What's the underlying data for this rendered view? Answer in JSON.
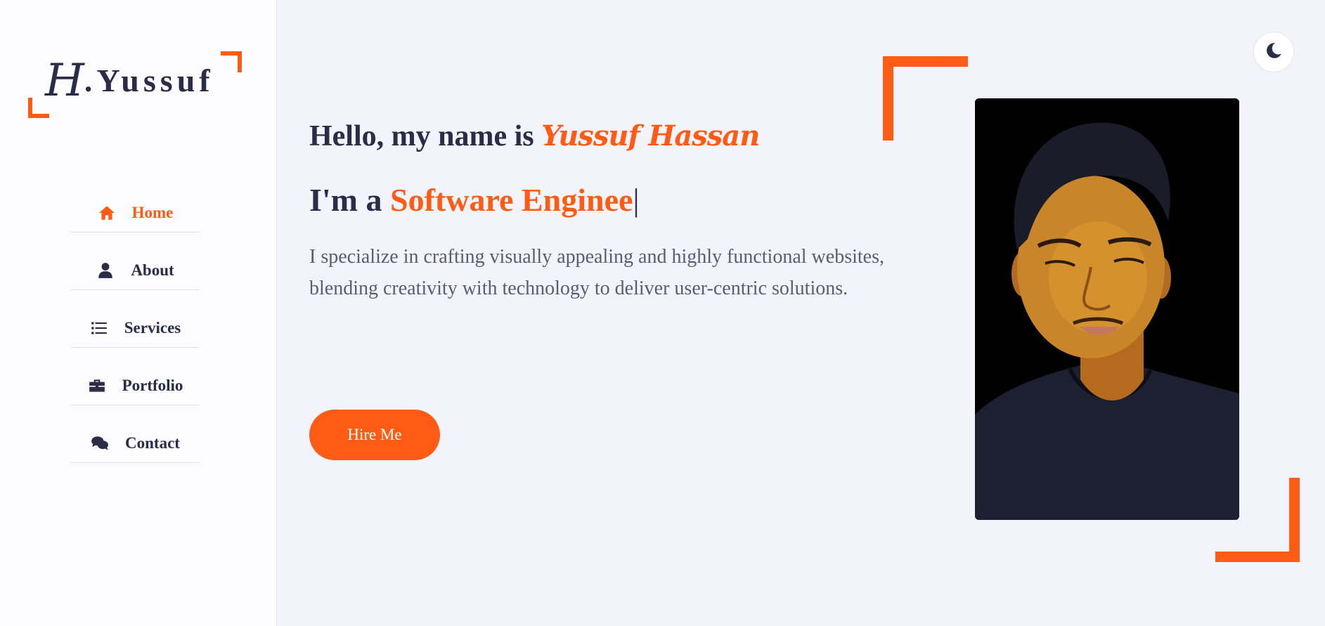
{
  "logo": {
    "initial": "H",
    "rest": ".Yussuf"
  },
  "nav": [
    {
      "label": "Home",
      "icon": "home-icon",
      "active": true
    },
    {
      "label": "About",
      "icon": "user-icon",
      "active": false
    },
    {
      "label": "Services",
      "icon": "list-icon",
      "active": false
    },
    {
      "label": "Portfolio",
      "icon": "briefcase-icon",
      "active": false
    },
    {
      "label": "Contact",
      "icon": "comments-icon",
      "active": false
    }
  ],
  "theme_toggle": {
    "icon": "moon-icon"
  },
  "hero": {
    "greeting": "Hello, my name is",
    "name": "Yussuf Hassan",
    "role_prefix": "I'm a",
    "role_text": "Software Enginee",
    "cursor": "|",
    "description": "I specialize in crafting visually appealing and highly functional websites, blending creativity with technology to deliver user-centric solutions.",
    "cta_label": "Hire Me"
  },
  "colors": {
    "accent": "#fe5c15",
    "text_dark": "#2a2c48",
    "text_muted": "#5a5c72",
    "background": "#f2f3fb",
    "sidebar_bg": "#fcfbfe"
  }
}
